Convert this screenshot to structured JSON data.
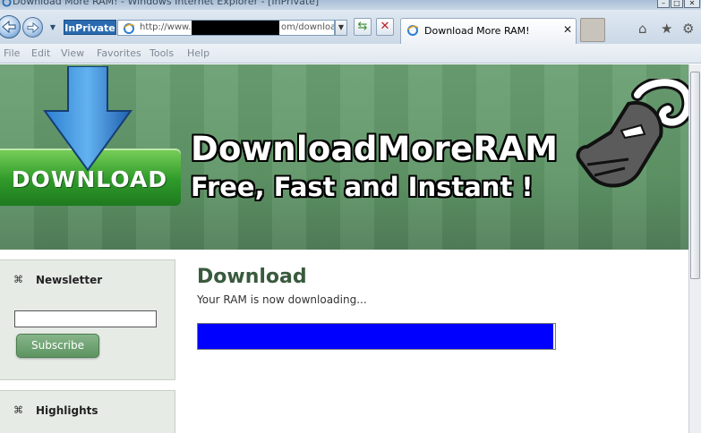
{
  "window": {
    "title": "Download More RAM! - Windows Internet Explorer - [InPrivate]",
    "controls": [
      "minimize",
      "maximize",
      "close"
    ]
  },
  "nav": {
    "inprivate_label": "InPrivate",
    "address_prefix": "http://www.",
    "address_suffix": "om/downloa",
    "tab_title": "Download More RAM!",
    "tab_close": "✕"
  },
  "menu": [
    "File",
    "Edit",
    "View",
    "Favorites",
    "Tools",
    "Help"
  ],
  "banner": {
    "download_word": "DOWNLOAD",
    "title": "DownloadMoreRAM",
    "tagline": "Free, Fast and Instant !",
    "icons": [
      "download-arrow-icon",
      "ram-logo"
    ]
  },
  "sidebar": {
    "newsletter": {
      "heading": "Newsletter",
      "input_value": "",
      "subscribe_label": "Subscribe"
    },
    "highlights": {
      "heading": "Highlights"
    },
    "heading_icon": "⌘"
  },
  "content": {
    "title": "Download",
    "status": "Your RAM is now downloading...",
    "progress_fraction": 0.995
  },
  "colors": {
    "progress": "#0000ff",
    "banner_green": "#5f9667",
    "inprivate": "#2a6bb0"
  }
}
